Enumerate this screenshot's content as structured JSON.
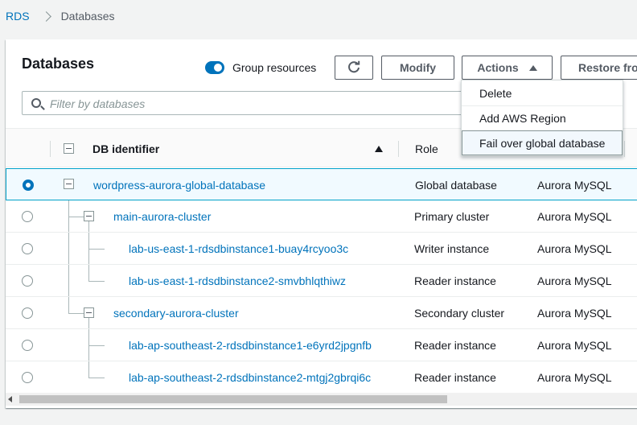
{
  "breadcrumb": {
    "root": "RDS",
    "current": "Databases"
  },
  "panel": {
    "title": "Databases",
    "group_toggle_label": "Group resources",
    "group_toggle_on": true
  },
  "toolbar": {
    "refresh_icon": "refresh-icon",
    "modify_label": "Modify",
    "actions_label": "Actions",
    "restore_label": "Restore fro"
  },
  "search": {
    "placeholder": "Filter by databases"
  },
  "actions_menu": {
    "items": [
      "Delete",
      "Add AWS Region",
      "Fail over global database"
    ],
    "highlighted": "Fail over global database"
  },
  "table": {
    "headers": {
      "identifier": "DB identifier",
      "role": "Role"
    },
    "sort": "ascending",
    "rows": [
      {
        "identifier": "wordpress-aurora-global-database",
        "role": "Global database",
        "engine": "Aurora MySQL",
        "selected": true
      },
      {
        "identifier": "main-aurora-cluster",
        "role": "Primary cluster",
        "engine": "Aurora MySQL",
        "selected": false
      },
      {
        "identifier": "lab-us-east-1-rdsdbinstance1-buay4rcyoo3c",
        "role": "Writer instance",
        "engine": "Aurora MySQL",
        "selected": false
      },
      {
        "identifier": "lab-us-east-1-rdsdbinstance2-smvbhlqthiwz",
        "role": "Reader instance",
        "engine": "Aurora MySQL",
        "selected": false
      },
      {
        "identifier": "secondary-aurora-cluster",
        "role": "Secondary cluster",
        "engine": "Aurora MySQL",
        "selected": false
      },
      {
        "identifier": "lab-ap-southeast-2-rdsdbinstance1-e6yrd2jpgnfb",
        "role": "Reader instance",
        "engine": "Aurora MySQL",
        "selected": false
      },
      {
        "identifier": "lab-ap-southeast-2-rdsdbinstance2-mtgj2gbrqi6c",
        "role": "Reader instance",
        "engine": "Aurora MySQL",
        "selected": false
      }
    ]
  },
  "colors": {
    "link": "#0073bb",
    "selected_row_bg": "#f1faff",
    "selected_row_border": "#00a1c9"
  }
}
